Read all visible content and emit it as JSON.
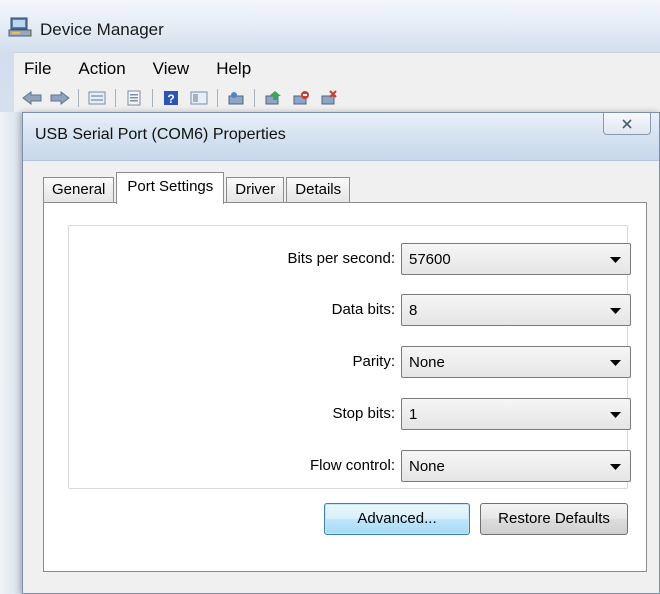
{
  "main_window": {
    "title": "Device Manager",
    "menu": [
      "File",
      "Action",
      "View",
      "Help"
    ]
  },
  "dialog": {
    "title": "USB Serial Port (COM6) Properties",
    "tabs": [
      "General",
      "Port Settings",
      "Driver",
      "Details"
    ],
    "active_tab": "Port Settings",
    "fields": [
      {
        "label": "Bits per second:",
        "value": "57600"
      },
      {
        "label": "Data bits:",
        "value": "8"
      },
      {
        "label": "Parity:",
        "value": "None"
      },
      {
        "label": "Stop bits:",
        "value": "1"
      },
      {
        "label": "Flow control:",
        "value": "None"
      }
    ],
    "buttons": {
      "advanced": "Advanced...",
      "restore": "Restore Defaults"
    }
  },
  "colors": {
    "focus_button_border": "#3c7fb1",
    "help_icon_blue": "#2b54b8",
    "disable_icon_red": "#d23a2a"
  }
}
